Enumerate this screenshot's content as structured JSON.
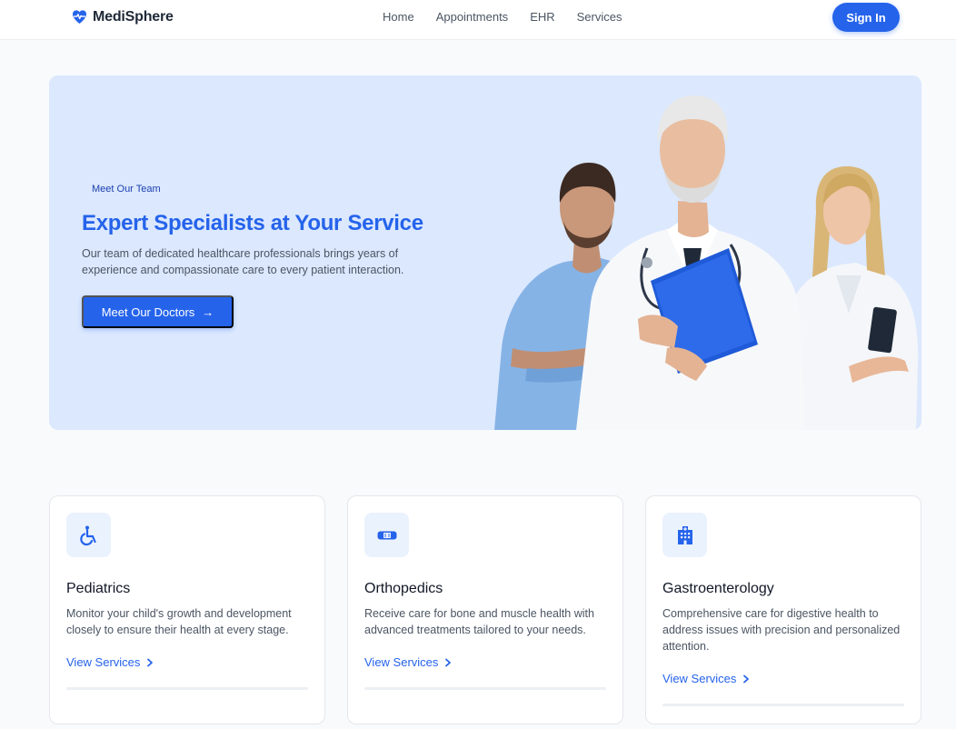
{
  "header": {
    "brand": "MediSphere",
    "nav": [
      {
        "label": "Home"
      },
      {
        "label": "Appointments"
      },
      {
        "label": "EHR"
      },
      {
        "label": "Services"
      }
    ],
    "signin_label": "Sign In"
  },
  "hero": {
    "eyebrow": "Meet Our Team",
    "title": "Expert Specialists at Your Service",
    "description": "Our team of dedicated healthcare professionals brings years of experience and compassionate care to every patient interaction.",
    "cta_label": "Meet Our Doctors",
    "cta_arrow": "→"
  },
  "cards": [
    {
      "icon": "wheelchair-icon",
      "title": "Pediatrics",
      "description": "Monitor your child's growth and development closely to ensure their health at every stage.",
      "link_label": "View Services"
    },
    {
      "icon": "bandage-icon",
      "title": "Orthopedics",
      "description": "Receive care for bone and muscle health with advanced treatments tailored to your needs.",
      "link_label": "View Services"
    },
    {
      "icon": "hospital-icon",
      "title": "Gastroenterology",
      "description": "Comprehensive care for digestive health to address issues with precision and personalized attention.",
      "link_label": "View Services"
    }
  ],
  "colors": {
    "primary": "#2563eb",
    "hero_bg": "#dbe8fe",
    "icon_bg": "#eaf2fe",
    "page_bg": "#f8fafc"
  }
}
